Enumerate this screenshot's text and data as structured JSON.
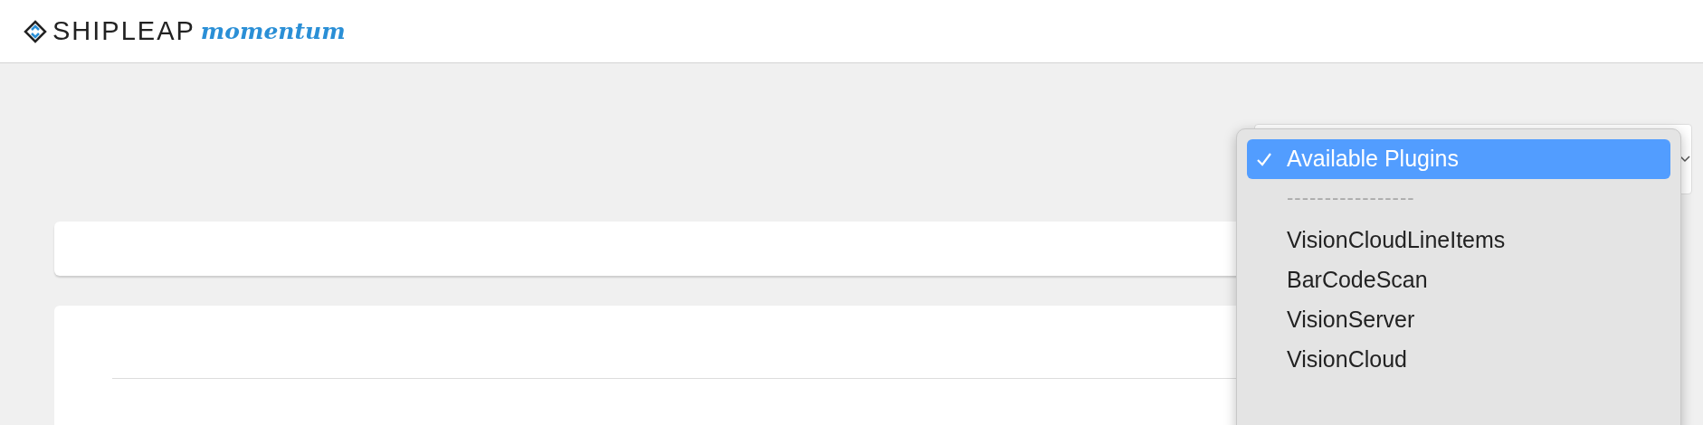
{
  "header": {
    "logo_text": "SHIPLEAP",
    "logo_script": "momentum"
  },
  "plugin_menu": {
    "items": [
      {
        "kind": "option",
        "label": "Available Plugins",
        "selected": true
      },
      {
        "kind": "separator",
        "label": "-----------------"
      },
      {
        "kind": "option",
        "label": "VisionCloudLineItems",
        "selected": false
      },
      {
        "kind": "option",
        "label": "BarCodeScan",
        "selected": false
      },
      {
        "kind": "option",
        "label": "VisionServer",
        "selected": false
      },
      {
        "kind": "option",
        "label": "VisionCloud",
        "selected": false
      }
    ]
  }
}
